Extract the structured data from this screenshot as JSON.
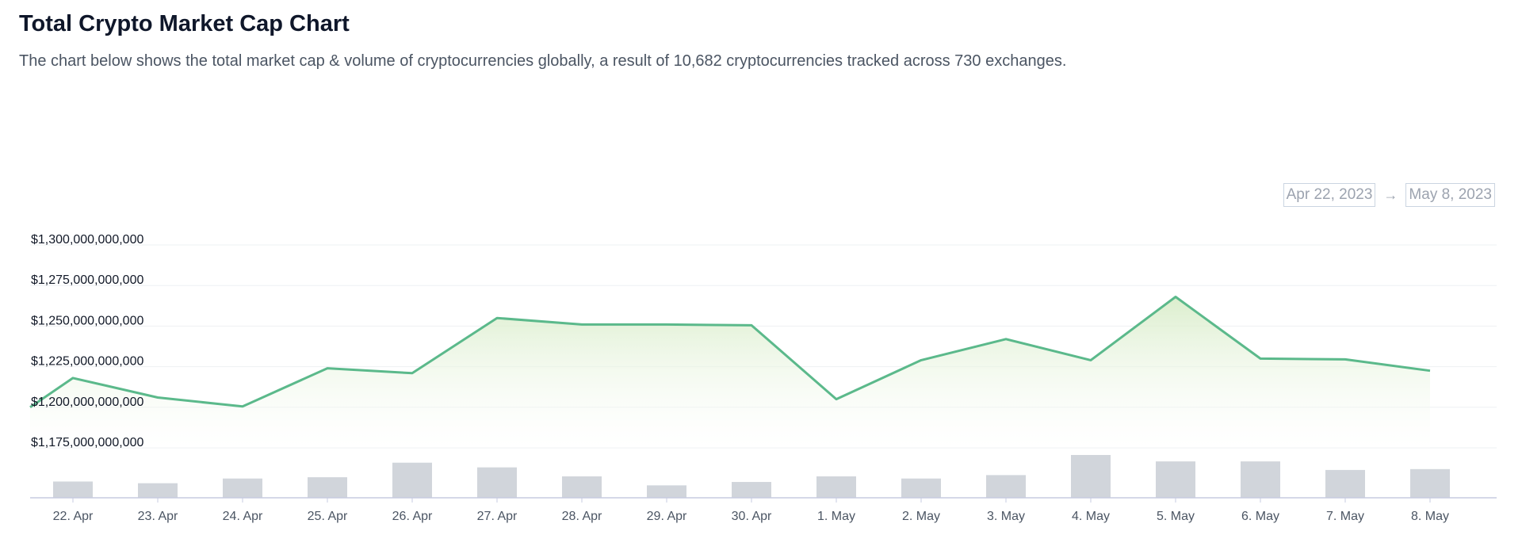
{
  "header": {
    "title": "Total Crypto Market Cap Chart",
    "subtitle": "The chart below shows the total market cap & volume of cryptocurrencies globally, a result of 10,682 cryptocurrencies tracked across 730 exchanges."
  },
  "date_range": {
    "from": "Apr 22, 2023",
    "arrow": "→",
    "to": "May 8, 2023"
  },
  "colors": {
    "line": "#5bb98b",
    "area_top": "#d7ecc7",
    "volume_bar": "#d1d5db",
    "grid": "#eef0f3",
    "axis": "#c7cbe0"
  },
  "chart_data": {
    "type": "area",
    "categories": [
      "22. Apr",
      "23. Apr",
      "24. Apr",
      "25. Apr",
      "26. Apr",
      "27. Apr",
      "28. Apr",
      "29. Apr",
      "30. Apr",
      "1. May",
      "2. May",
      "3. May",
      "4. May",
      "5. May",
      "6. May",
      "7. May",
      "8. May"
    ],
    "y_ticks": [
      "$1,175,000,000,000",
      "$1,200,000,000,000",
      "$1,225,000,000,000",
      "$1,250,000,000,000",
      "$1,275,000,000,000",
      "$1,300,000,000,000"
    ],
    "ylim": [
      1175000000000,
      1300000000000
    ],
    "grid": true,
    "series": [
      {
        "type": "line",
        "x": [
          "2023-04-22",
          "2023-04-22",
          "2023-04-23",
          "2023-04-24",
          "2023-04-25",
          "2023-04-26",
          "2023-04-27",
          "2023-04-28",
          "2023-04-29",
          "2023-04-30",
          "2023-05-01",
          "2023-05-02",
          "2023-05-03",
          "2023-05-04",
          "2023-05-05",
          "2023-05-06",
          "2023-05-07",
          "2023-05-08"
        ],
        "values": [
          1200000000000,
          1218000000000,
          1206000000000,
          1200500000000,
          1224000000000,
          1221000000000,
          1255000000000,
          1251000000000,
          1251000000000,
          1250500000000,
          1205000000000,
          1229000000000,
          1242000000000,
          1229000000000,
          1268000000000,
          1230000000000,
          1229500000000,
          1222500000000
        ]
      },
      {
        "type": "bar",
        "values": [
          0.38,
          0.34,
          0.45,
          0.48,
          0.82,
          0.71,
          0.5,
          0.29,
          0.37,
          0.5,
          0.45,
          0.53,
          1.0,
          0.85,
          0.85,
          0.65,
          0.67
        ]
      }
    ]
  }
}
